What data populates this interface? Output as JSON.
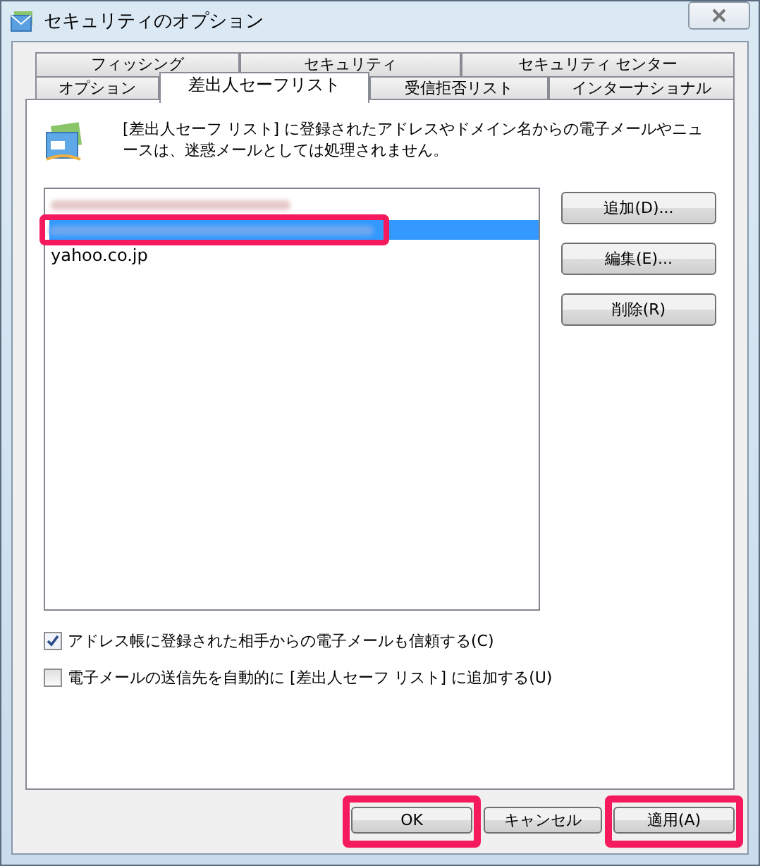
{
  "window": {
    "title": "セキュリティのオプション"
  },
  "tab_rows": [
    [
      {
        "label": "フィッシング",
        "selected": false
      },
      {
        "label": "セキュリティ",
        "selected": false
      },
      {
        "label": "セキュリティ センター",
        "selected": false
      }
    ],
    [
      {
        "label": "オプション",
        "selected": false
      },
      {
        "label": "差出人セーフリスト",
        "selected": true
      },
      {
        "label": "受信拒否リスト",
        "selected": false
      },
      {
        "label": "インターナショナル",
        "selected": false
      }
    ]
  ],
  "description": "[差出人セーフ リスト] に登録されたアドレスやドメイン名からの電子メールやニュースは、迷惑メールとしては処理されません。",
  "list": [
    {
      "kind": "redacted",
      "selected": false,
      "highlighted": false
    },
    {
      "kind": "redacted",
      "selected": true,
      "highlighted": true
    },
    {
      "kind": "text",
      "text": "yahoo.co.jp",
      "selected": false,
      "highlighted": false
    }
  ],
  "side_buttons": [
    "追加(D)...",
    "編集(E)...",
    "削除(R)"
  ],
  "options": [
    {
      "label": "アドレス帳に登録された相手からの電子メールも信頼する(C)",
      "checked": true
    },
    {
      "label": "電子メールの送信先を自動的に [差出人セーフ リスト] に追加する(U)",
      "checked": false
    }
  ],
  "footer_buttons": [
    {
      "label": "OK",
      "highlighted": true
    },
    {
      "label": "キャンセル",
      "highlighted": false
    },
    {
      "label": "適用(A)",
      "highlighted": true
    }
  ]
}
